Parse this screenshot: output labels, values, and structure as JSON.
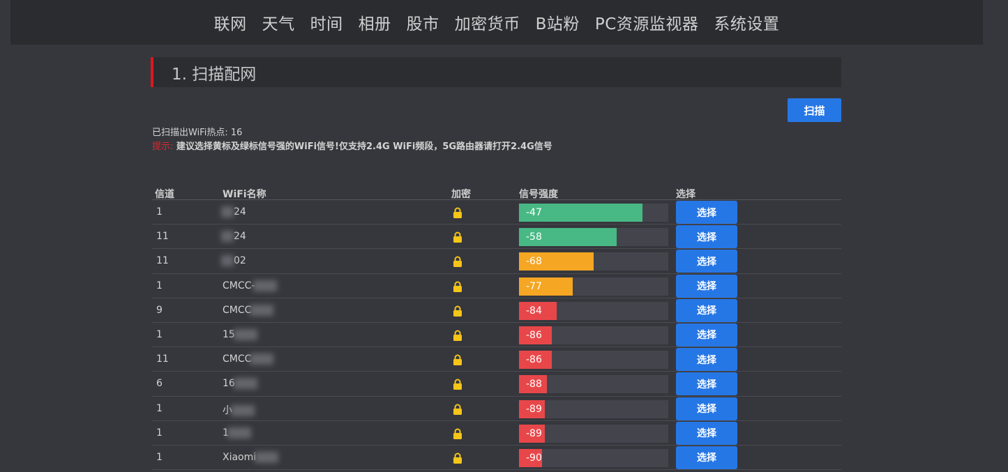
{
  "nav": {
    "items": [
      "联网",
      "天气",
      "时间",
      "相册",
      "股市",
      "加密货币",
      "B站粉",
      "PC资源监视器",
      "系统设置"
    ]
  },
  "section": {
    "title": "1. 扫描配网"
  },
  "scan_button": "扫描",
  "scan_count": "已扫描出WiFi热点: 16",
  "hint": {
    "label": "提示:",
    "text": " 建议选择黄标及绿标信号强的WiFi信号!仅支持2.4G WiFi频段，5G路由器请打开2.4G信号"
  },
  "table": {
    "headers": {
      "channel": "信道",
      "name": "WiFi名称",
      "encryption": "加密",
      "signal": "信号强度",
      "select": "选择"
    },
    "select_label": "选择",
    "scale_min": -100,
    "scale_max": -20,
    "colors": {
      "strong": "#48b984",
      "medium": "#f5a623",
      "weak": "#e8474a"
    },
    "rows": [
      {
        "channel": "1",
        "name": "24",
        "signal": -47
      },
      {
        "channel": "11",
        "name": "24",
        "signal": -58
      },
      {
        "channel": "11",
        "name": "02",
        "signal": -68
      },
      {
        "channel": "1",
        "name": "CMCC-",
        "signal": -77
      },
      {
        "channel": "9",
        "name": "CMCC",
        "signal": -84
      },
      {
        "channel": "1",
        "name": "15",
        "signal": -86
      },
      {
        "channel": "11",
        "name": "CMCC",
        "signal": -86
      },
      {
        "channel": "6",
        "name": "16",
        "signal": -88
      },
      {
        "channel": "1",
        "name": "小",
        "signal": -89
      },
      {
        "channel": "1",
        "name": "1",
        "signal": -89
      },
      {
        "channel": "1",
        "name": "Xiaomi",
        "signal": -90
      }
    ]
  }
}
